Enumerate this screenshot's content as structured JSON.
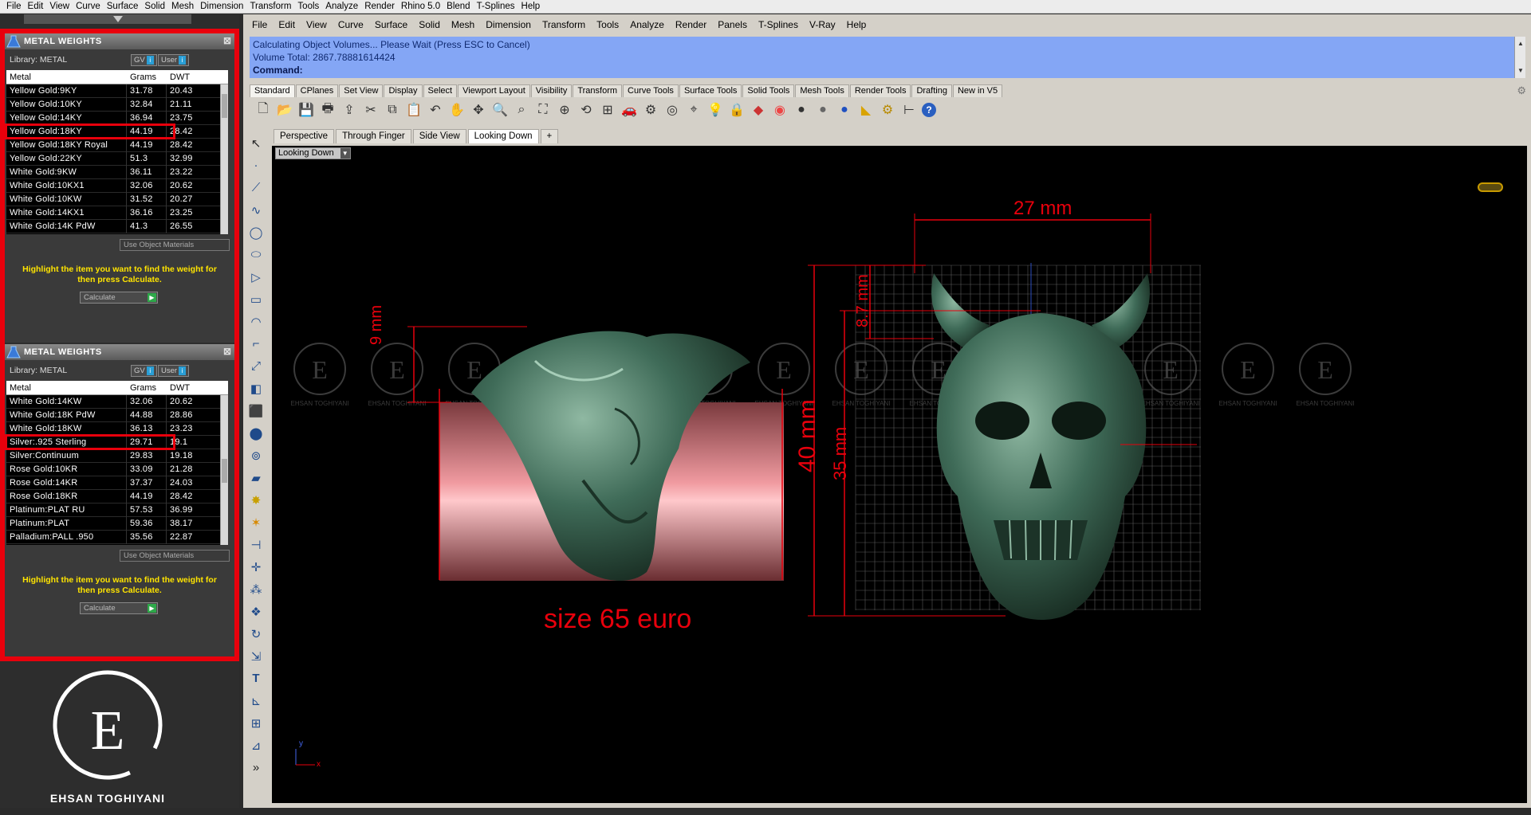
{
  "top_menu": [
    "File",
    "Edit",
    "View",
    "Curve",
    "Surface",
    "Solid",
    "Mesh",
    "Dimension",
    "Transform",
    "Tools",
    "Analyze",
    "Render",
    "Rhino 5.0",
    "Blend",
    "T-Splines",
    "Help"
  ],
  "panels": [
    {
      "title": "METAL WEIGHTS",
      "library_label": "Library: METAL",
      "btn_gv": "GV",
      "btn_user": "User",
      "led": "i",
      "headers": [
        "Metal",
        "Grams",
        "DWT"
      ],
      "rows": [
        [
          "Yellow Gold:9KY",
          "31.78",
          "20.43"
        ],
        [
          "Yellow Gold:10KY",
          "32.84",
          "21.11"
        ],
        [
          "Yellow Gold:14KY",
          "36.94",
          "23.75"
        ],
        [
          "Yellow Gold:18KY",
          "44.19",
          "28.42"
        ],
        [
          "Yellow Gold:18KY Royal",
          "44.19",
          "28.42"
        ],
        [
          "Yellow Gold:22KY",
          "51.3",
          "32.99"
        ],
        [
          "White Gold:9KW",
          "36.11",
          "23.22"
        ],
        [
          "White Gold:10KX1",
          "32.06",
          "20.62"
        ],
        [
          "White Gold:10KW",
          "31.52",
          "20.27"
        ],
        [
          "White Gold:14KX1",
          "36.16",
          "23.25"
        ],
        [
          "White Gold:14K PdW",
          "41.3",
          "26.55"
        ]
      ],
      "selected_index": 3,
      "use_object_materials": "Use Object Materials",
      "hint": "Highlight the item you want to find the weight for then press Calculate.",
      "calculate": "Calculate"
    },
    {
      "title": "METAL WEIGHTS",
      "library_label": "Library: METAL",
      "btn_gv": "GV",
      "btn_user": "User",
      "led": "i",
      "headers": [
        "Metal",
        "Grams",
        "DWT"
      ],
      "rows": [
        [
          "White Gold:14KW",
          "32.06",
          "20.62"
        ],
        [
          "White Gold:18K PdW",
          "44.88",
          "28.86"
        ],
        [
          "White Gold:18KW",
          "36.13",
          "23.23"
        ],
        [
          "Silver:.925 Sterling",
          "29.71",
          "19.1"
        ],
        [
          "Silver:Continuum",
          "29.83",
          "19.18"
        ],
        [
          "Rose Gold:10KR",
          "33.09",
          "21.28"
        ],
        [
          "Rose Gold:14KR",
          "37.37",
          "24.03"
        ],
        [
          "Rose Gold:18KR",
          "44.19",
          "28.42"
        ],
        [
          "Platinum:PLAT RU",
          "57.53",
          "36.99"
        ],
        [
          "Platinum:PLAT",
          "59.36",
          "38.17"
        ],
        [
          "Palladium:PALL .950",
          "35.56",
          "22.87"
        ]
      ],
      "selected_index": 3,
      "use_object_materials": "Use Object Materials",
      "hint": "Highlight the item you want to find the weight for then press Calculate.",
      "calculate": "Calculate"
    }
  ],
  "logo": {
    "letter": "E",
    "name": "EHSAN TOGHIYANI"
  },
  "rhino_menu": [
    "File",
    "Edit",
    "View",
    "Curve",
    "Surface",
    "Solid",
    "Mesh",
    "Dimension",
    "Transform",
    "Tools",
    "Analyze",
    "Render",
    "Panels",
    "T-Splines",
    "V-Ray",
    "Help"
  ],
  "command": {
    "line1": "Calculating Object Volumes... Please Wait (Press ESC to Cancel)",
    "line2": "Volume Total: 2867.78881614424",
    "prompt": "Command:"
  },
  "toolbar_tabs": [
    "Standard",
    "CPlanes",
    "Set View",
    "Display",
    "Select",
    "Viewport Layout",
    "Visibility",
    "Transform",
    "Curve Tools",
    "Surface Tools",
    "Solid Tools",
    "Mesh Tools",
    "Render Tools",
    "Drafting",
    "New in V5"
  ],
  "viewport_tabs": [
    "Perspective",
    "Through Finger",
    "Side View",
    "Looking Down"
  ],
  "active_viewport": "Looking Down",
  "viewport_title": "Looking Down",
  "dimensions": {
    "side_height": "9 mm",
    "width": "27 mm",
    "total_height": "40 mm",
    "face_height": "35 mm",
    "horn_height": "8.7 mm"
  },
  "size_label": "size 65 euro",
  "watermark_name": "EHSAN TOGHIYANI",
  "axis": {
    "x": "x",
    "y": "y"
  },
  "colors": {
    "accent_red": "#e8000c",
    "model_green": "#3f6b58",
    "ring_pink": "#e5868b",
    "command_blue": "#84a6f5",
    "hint_yellow": "#ffe400"
  }
}
